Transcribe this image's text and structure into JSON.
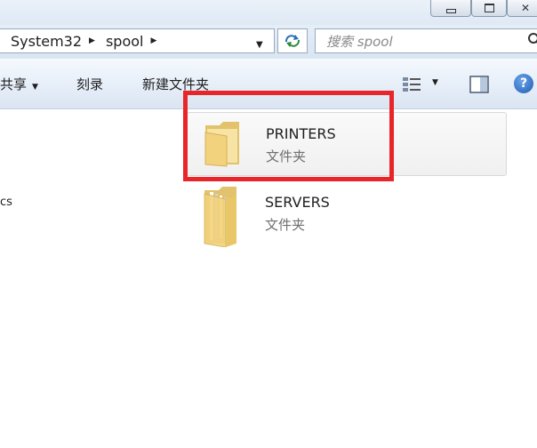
{
  "window": {
    "controls": {
      "minimize": "minimize",
      "maximize": "maximize",
      "close": "close"
    }
  },
  "address_bar": {
    "crumbs": [
      "System32",
      "spool"
    ]
  },
  "search": {
    "placeholder": "搜索 spool"
  },
  "toolbar": {
    "share_label": "共享",
    "burn_label": "刻录",
    "new_folder_label": "新建文件夹"
  },
  "nav": {
    "fragment_1": "cs"
  },
  "files": [
    {
      "name": "PRINTERS",
      "type": "文件夹",
      "selected": true
    },
    {
      "name": "SERVERS",
      "type": "文件夹",
      "selected": false
    }
  ],
  "annotation": {
    "highlight_color": "#e8262a"
  },
  "icons": [
    "minimize-icon",
    "maximize-icon",
    "close-icon",
    "chevron-right-icon",
    "dropdown-icon",
    "refresh-icon",
    "search-icon",
    "view-options-icon",
    "preview-pane-icon",
    "help-icon",
    "folder-icon"
  ]
}
